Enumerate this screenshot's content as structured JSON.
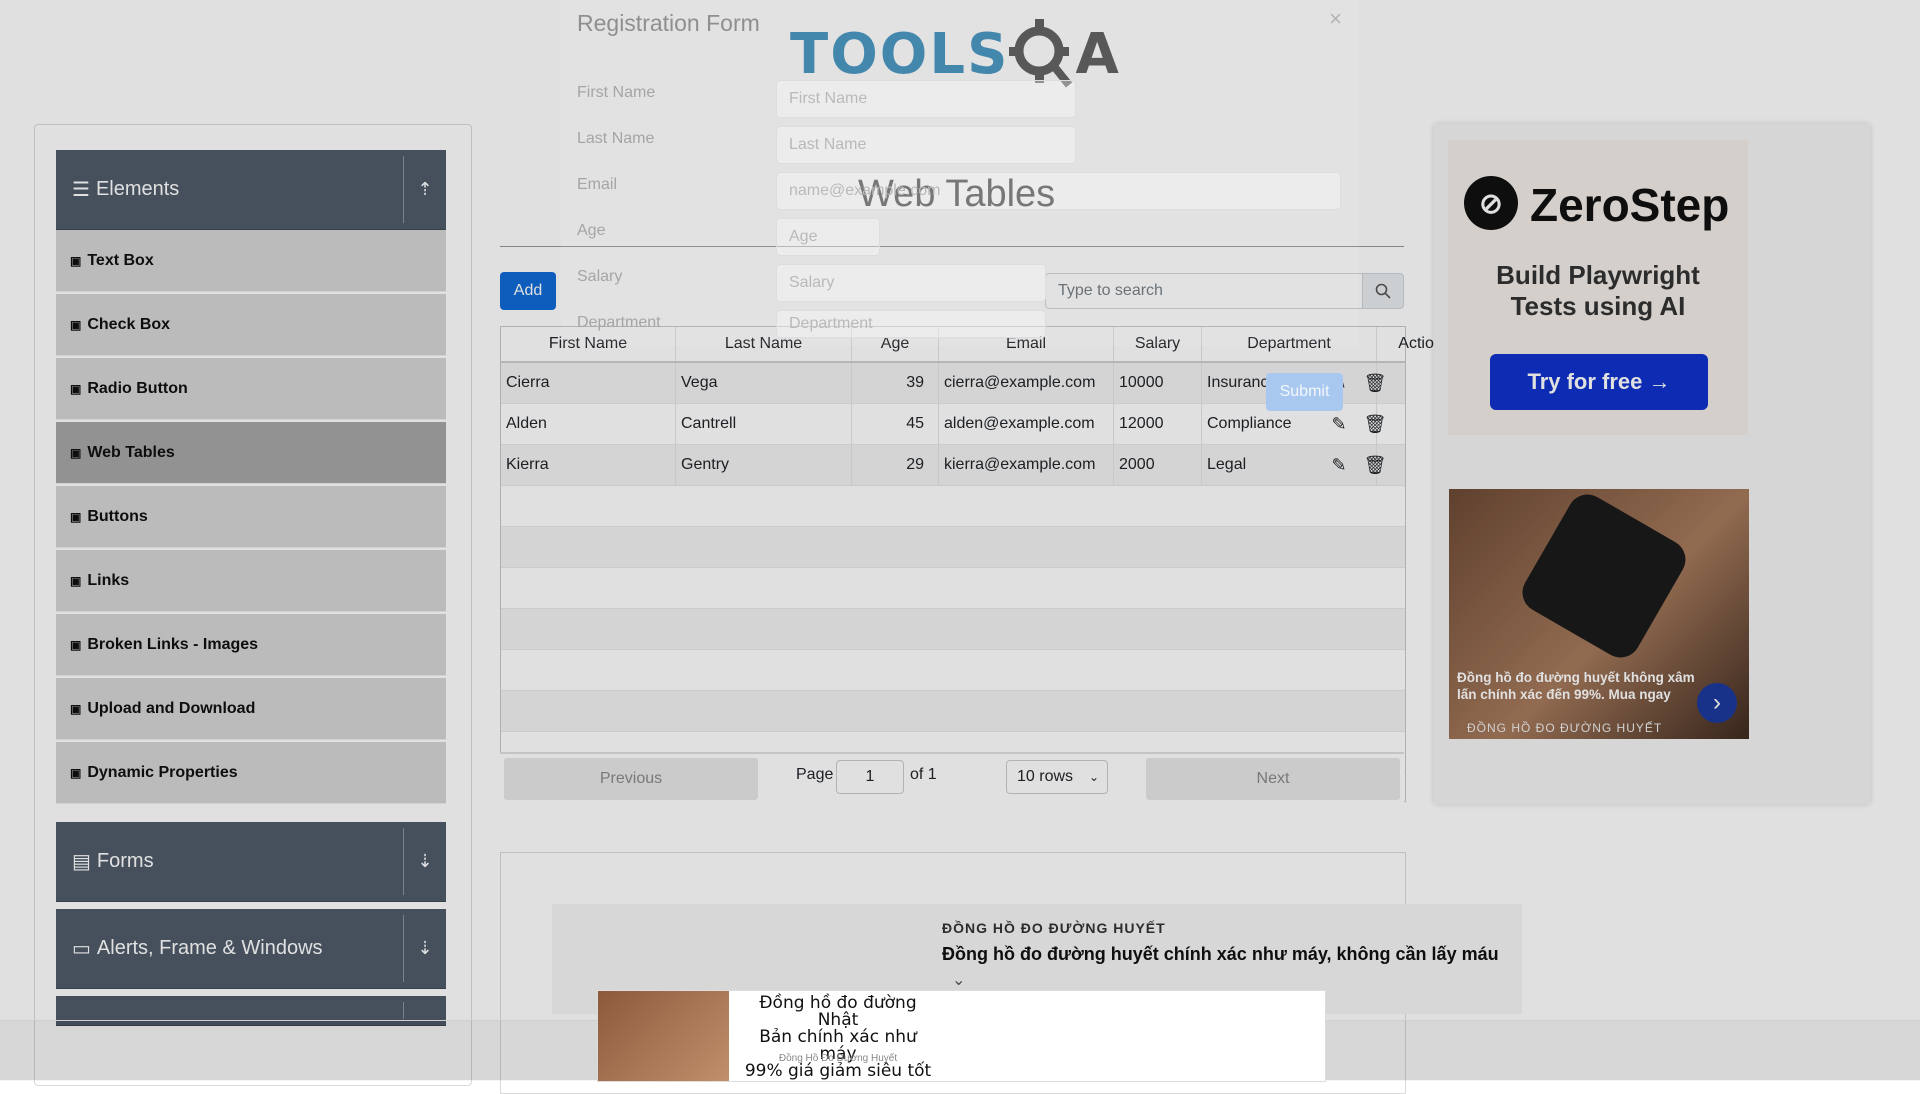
{
  "logo": {
    "text": "TOOLS",
    "suffix": "A"
  },
  "page_title": "Web Tables",
  "sidebar": {
    "groups": [
      {
        "label": "Elements",
        "arrow": "⇡"
      },
      {
        "label": "Forms",
        "arrow": "⇣"
      },
      {
        "label": "Alerts, Frame & Windows",
        "arrow": "⇣"
      }
    ],
    "items": [
      {
        "label": "Text Box"
      },
      {
        "label": "Check Box"
      },
      {
        "label": "Radio Button"
      },
      {
        "label": "Web Tables"
      },
      {
        "label": "Buttons"
      },
      {
        "label": "Links"
      },
      {
        "label": "Broken Links - Images"
      },
      {
        "label": "Upload and Download"
      },
      {
        "label": "Dynamic Properties"
      }
    ]
  },
  "toolbar": {
    "add_label": "Add",
    "search_placeholder": "Type to search"
  },
  "table": {
    "headers": [
      "First Name",
      "Last Name",
      "Age",
      "Email",
      "Salary",
      "Department",
      "Action"
    ],
    "rows": [
      [
        "Cierra",
        "Vega",
        "39",
        "cierra@example.com",
        "10000",
        "Insurance"
      ],
      [
        "Alden",
        "Cantrell",
        "45",
        "alden@example.com",
        "12000",
        "Compliance"
      ],
      [
        "Kierra",
        "Gentry",
        "29",
        "kierra@example.com",
        "2000",
        "Legal"
      ]
    ]
  },
  "pagination": {
    "previous": "Previous",
    "page_label": "Page",
    "page_value": "1",
    "of_label": "of 1",
    "rows_option": "10 rows",
    "next": "Next"
  },
  "modal": {
    "title": "Registration Form",
    "close": "×",
    "fields": [
      {
        "label": "First Name",
        "placeholder": "First Name"
      },
      {
        "label": "Last Name",
        "placeholder": "Last Name"
      },
      {
        "label": "Email",
        "placeholder": "name@example.com"
      },
      {
        "label": "Age",
        "placeholder": "Age"
      },
      {
        "label": "Salary",
        "placeholder": "Salary"
      },
      {
        "label": "Department",
        "placeholder": "Department"
      }
    ],
    "submit": "Submit"
  },
  "ad_zerostep": {
    "brand": "ZeroStep",
    "tagline_1": "Build Playwright",
    "tagline_2": "Tests using AI",
    "cta": "Try for free →"
  },
  "ad_watch": {
    "caption": "Đồng hồ đo đường huyết không xâm lấn chính xác đến 99%. Mua ngay",
    "brand": "ĐỒNG HỒ ĐO ĐƯỜNG HUYẾT"
  },
  "ad_bottom": {
    "small": "ĐỒNG HỒ ĐO ĐƯỜNG HUYẾT",
    "headline": "Đồng hồ đo đường huyết chính xác như máy, không cần lấy máu"
  },
  "ad_sticky": {
    "line1": "Đồng hồ đo đường Nhật",
    "line2": "Bản chính xác như máy",
    "line3": "99% giá giảm siêu tốt",
    "brand": "Đồng Hồ Đo Đường Huyết"
  },
  "colors": {
    "accent": "#0f6ad6",
    "sidebar_header": "#505c6a",
    "logo_blue": "#3d8fbd"
  }
}
